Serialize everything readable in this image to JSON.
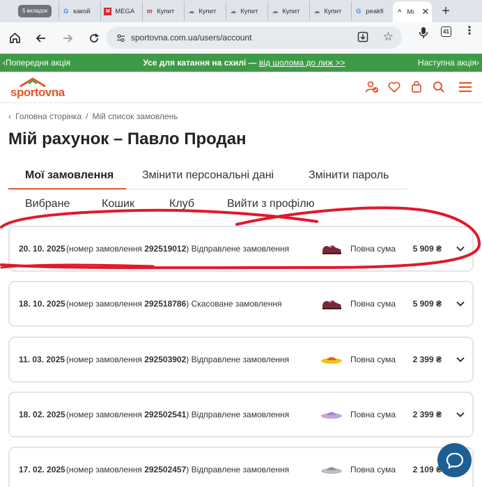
{
  "browser": {
    "tab_count_badge": "5 вкладок",
    "tabs": [
      {
        "label": "какой",
        "icon": "google-icon"
      },
      {
        "label": "MEGA",
        "icon": "mega-icon"
      },
      {
        "label": "Купит",
        "icon": "sport-m-icon"
      },
      {
        "label": "Купит",
        "icon": "cloud-icon"
      },
      {
        "label": "Купит",
        "icon": "cloud-icon"
      },
      {
        "label": "Купит",
        "icon": "cloud-icon"
      },
      {
        "label": "Купит",
        "icon": "cloud-icon"
      },
      {
        "label": "peakfi",
        "icon": "google-icon"
      },
      {
        "label": "Мі",
        "icon": "sportovna-icon",
        "active": true
      }
    ],
    "url": "sportovna.com.ua/users/account",
    "tabs_open": "41"
  },
  "promo": {
    "prev": "Попередня акція",
    "text": "Усе для катання на схилі —",
    "link": "від шолома до лиж >>",
    "next": "Наступна акція"
  },
  "header": {
    "logo": "sportovna",
    "brand_color": "#e2572b"
  },
  "breadcrumb": {
    "home": "Головна сторінка",
    "sep": "/",
    "current": "Мій список замовлень"
  },
  "page_title": "Мій рахунок – Павло Продан",
  "nav_tabs": {
    "orders": "Мої замовлення",
    "personal": "Змінити персональні дані",
    "password": "Змінити пароль",
    "favorites": "Вибране",
    "cart": "Кошик",
    "club": "Клуб",
    "logout": "Вийти з профілю"
  },
  "orders": [
    {
      "date": "20. 10. 2025",
      "prefix": "(номер замовлення ",
      "number": "292519012",
      "suffix": ")",
      "status": "Відправлене замовлення",
      "total_label": "Повна сума",
      "sum": "5 909 ₴",
      "product": "shoe-burgundy"
    },
    {
      "date": "18. 10. 2025",
      "prefix": "(номер замовлення ",
      "number": "292518786",
      "suffix": ")",
      "status": "Скасоване замовлення",
      "total_label": "Повна сума",
      "sum": "5 909 ₴",
      "product": "shoe-burgundy"
    },
    {
      "date": "11. 03. 2025",
      "prefix": "(номер замовлення ",
      "number": "292503902",
      "suffix": ")",
      "status": "Відправлене замовлення",
      "total_label": "Повна сума",
      "sum": "2 399 ₴",
      "product": "slide-yellow"
    },
    {
      "date": "18. 02. 2025",
      "prefix": "(номер замовлення ",
      "number": "292502541",
      "suffix": ")",
      "status": "Відправлене замовлення",
      "total_label": "Повна сума",
      "sum": "2 399 ₴",
      "product": "slide-lilac"
    },
    {
      "date": "17. 02. 2025",
      "prefix": "(номер замовлення ",
      "number": "292502457",
      "suffix": ")",
      "status": "Відправлене замовлення",
      "total_label": "Повна сума",
      "sum": "2 109 ₴",
      "product": "slide-grey"
    }
  ]
}
